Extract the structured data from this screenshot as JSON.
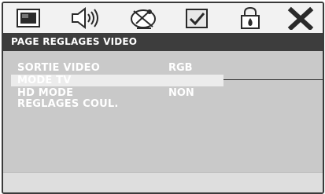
{
  "tabs": [
    {
      "icon": "monitor-icon"
    },
    {
      "icon": "speaker-icon"
    },
    {
      "icon": "satellite-dish-icon"
    },
    {
      "icon": "checkbox-icon"
    },
    {
      "icon": "lock-icon"
    },
    {
      "icon": "close-icon"
    }
  ],
  "header": {
    "title": "PAGE REGLAGES VIDEO"
  },
  "menu": {
    "items": [
      {
        "label": "SORTIE VIDEO",
        "value": "RGB"
      },
      {
        "label": "MODE TV",
        "value": ""
      },
      {
        "label": "HD MODE",
        "value": "NON"
      },
      {
        "label": "REGLAGES COUL.",
        "value": ""
      }
    ],
    "selected_index": 1
  },
  "colors": {
    "header_bg": "#3d3d3d",
    "panel_bg": "#c9c9c9",
    "selected_bg": "#ececec",
    "text": "#ffffff"
  }
}
